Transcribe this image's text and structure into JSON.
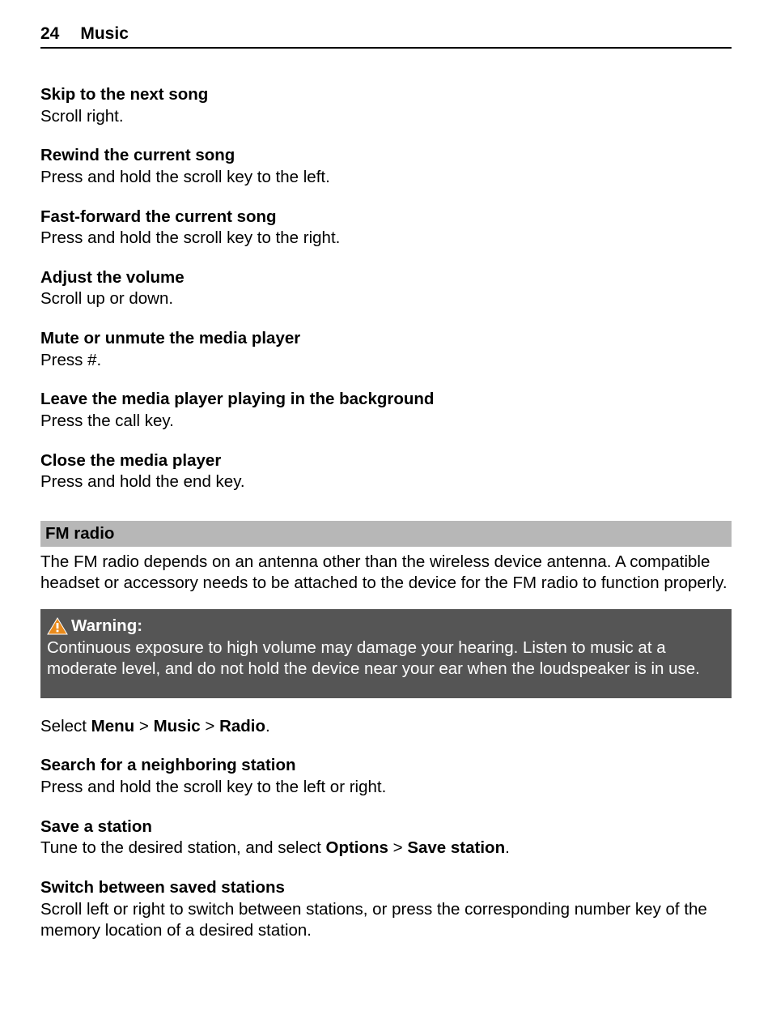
{
  "header": {
    "page_number": "24",
    "chapter": "Music"
  },
  "music_controls": [
    {
      "title": "Skip to the next song",
      "body": "Scroll right."
    },
    {
      "title": "Rewind the current song",
      "body": "Press and hold the scroll key to the left."
    },
    {
      "title": "Fast-forward the current song",
      "body": "Press and hold the scroll key to the right."
    },
    {
      "title": "Adjust the volume",
      "body": "Scroll up or down."
    },
    {
      "title": "Mute or unmute the media player",
      "body": "Press #."
    },
    {
      "title": "Leave the media player playing in the background",
      "body": "Press the call key."
    },
    {
      "title": "Close the media player",
      "body": "Press and hold the end key."
    }
  ],
  "fm_radio": {
    "section_title": "FM radio",
    "intro": "The FM radio depends on an antenna other than the wireless device antenna. A compatible headset or accessory needs to be attached to the device for the FM radio to function properly.",
    "warning_label": "Warning:",
    "warning_body": "Continuous exposure to high volume may damage your hearing. Listen to music at a moderate level, and do not hold the device near your ear when the loudspeaker is in use.",
    "select_path": {
      "prefix": "Select ",
      "seg1": "Menu",
      "sep1": " > ",
      "seg2": "Music",
      "sep2": " > ",
      "seg3": "Radio",
      "suffix": "."
    },
    "search": {
      "title": "Search for a neighboring station",
      "body": "Press and hold the scroll key to the left or right."
    },
    "save": {
      "title": "Save a station",
      "body_prefix": "Tune to the desired station, and select ",
      "options": "Options",
      "sep": " > ",
      "save_station": "Save station",
      "suffix": "."
    },
    "switch": {
      "title": "Switch between saved stations",
      "body": "Scroll left or right to switch between stations, or press the corresponding number key of the memory location of a desired station."
    }
  }
}
